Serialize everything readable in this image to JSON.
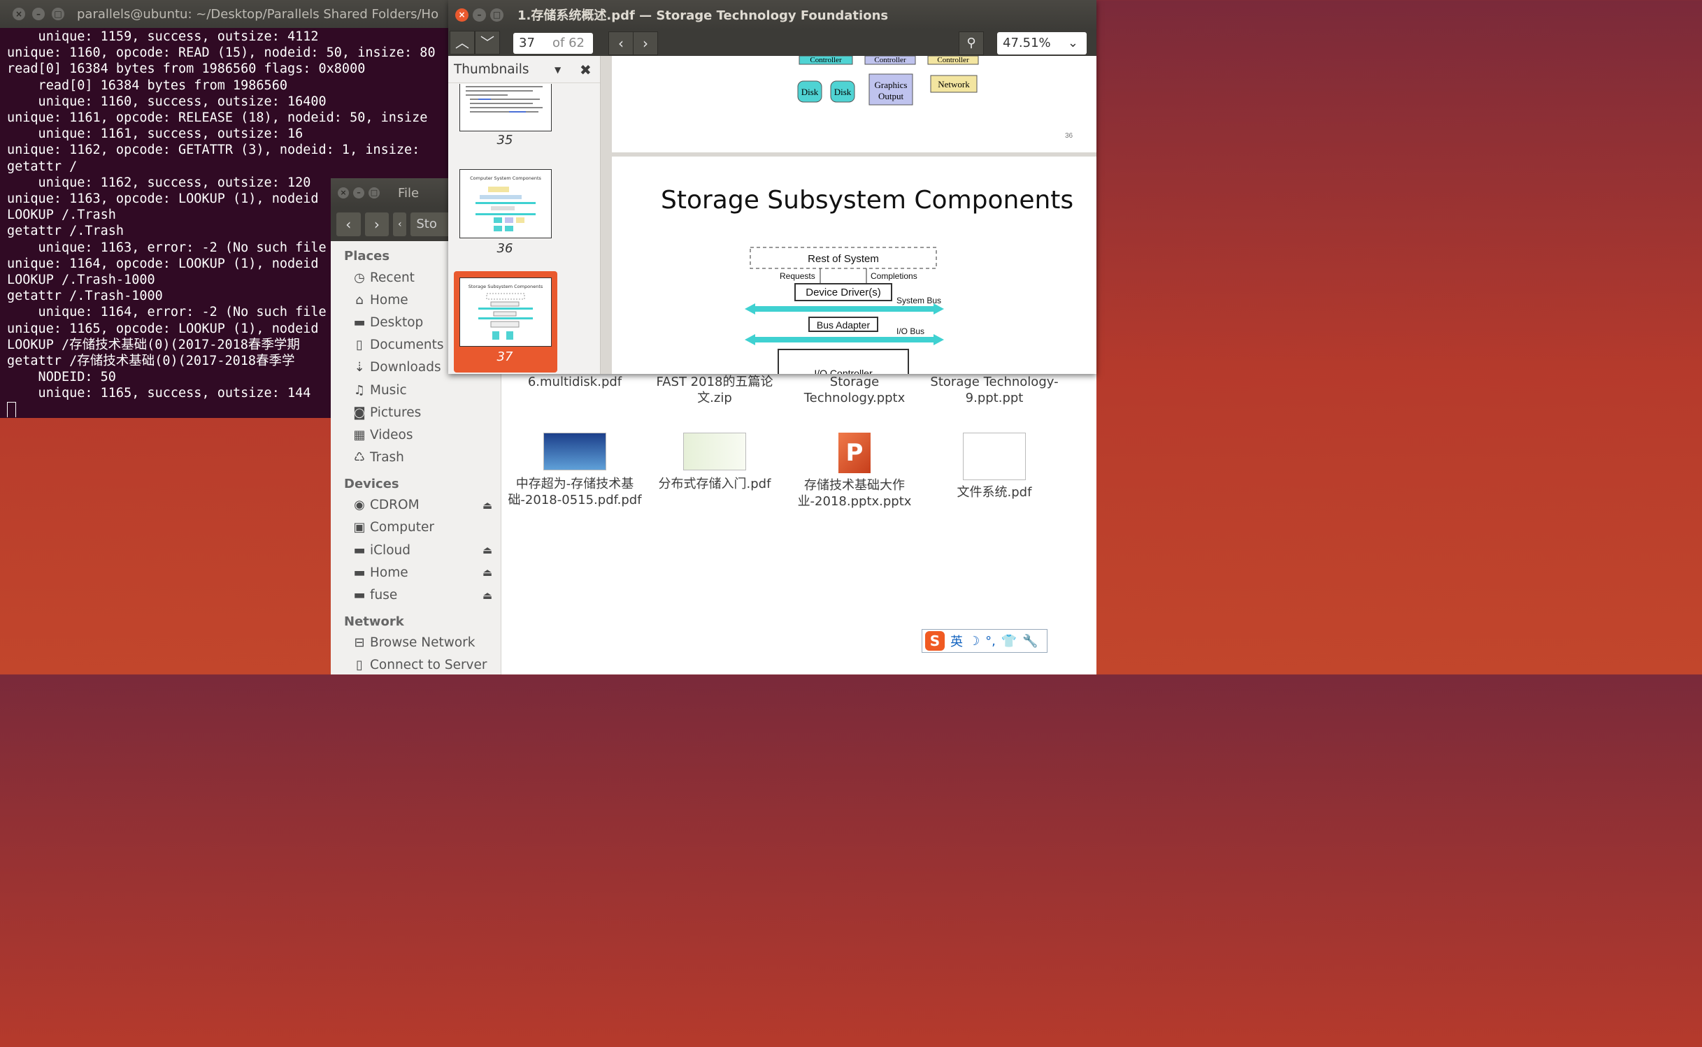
{
  "terminal": {
    "title": "parallels@ubuntu: ~/Desktop/Parallels Shared Folders/Ho",
    "lines": [
      "    unique: 1159, success, outsize: 4112",
      "unique: 1160, opcode: READ (15), nodeid: 50, insize: 80",
      "read[0] 16384 bytes from 1986560 flags: 0x8000",
      "    read[0] 16384 bytes from 1986560",
      "    unique: 1160, success, outsize: 16400",
      "unique: 1161, opcode: RELEASE (18), nodeid: 50, insize",
      "    unique: 1161, success, outsize: 16",
      "unique: 1162, opcode: GETATTR (3), nodeid: 1, insize: ",
      "getattr /",
      "    unique: 1162, success, outsize: 120",
      "unique: 1163, opcode: LOOKUP (1), nodeid",
      "LOOKUP /.Trash",
      "getattr /.Trash",
      "    unique: 1163, error: -2 (No such file",
      "unique: 1164, opcode: LOOKUP (1), nodeid",
      "LOOKUP /.Trash-1000",
      "getattr /.Trash-1000",
      "    unique: 1164, error: -2 (No such file",
      "unique: 1165, opcode: LOOKUP (1), nodeid",
      "LOOKUP /存储技术基础(0)(2017-2018春季学期",
      "getattr /存储技术基础(0)(2017-2018春季学",
      "    NODEID: 50",
      "    unique: 1165, success, outsize: 144"
    ]
  },
  "files": {
    "title": "File",
    "path_label": "Sto",
    "places_heading": "Places",
    "places": [
      {
        "icon": "clock-icon",
        "glyph": "◷",
        "label": "Recent"
      },
      {
        "icon": "home-icon",
        "glyph": "⌂",
        "label": "Home"
      },
      {
        "icon": "folder-icon",
        "glyph": "▬",
        "label": "Desktop"
      },
      {
        "icon": "document-icon",
        "glyph": "▯",
        "label": "Documents"
      },
      {
        "icon": "download-icon",
        "glyph": "⇣",
        "label": "Downloads"
      },
      {
        "icon": "music-icon",
        "glyph": "♫",
        "label": "Music"
      },
      {
        "icon": "camera-icon",
        "glyph": "◙",
        "label": "Pictures"
      },
      {
        "icon": "film-icon",
        "glyph": "▦",
        "label": "Videos"
      },
      {
        "icon": "trash-icon",
        "glyph": "♺",
        "label": "Trash"
      }
    ],
    "devices_heading": "Devices",
    "devices": [
      {
        "icon": "disc-icon",
        "glyph": "◉",
        "label": "CDROM",
        "eject": true
      },
      {
        "icon": "computer-icon",
        "glyph": "▣",
        "label": "Computer",
        "eject": false
      },
      {
        "icon": "drive-icon",
        "glyph": "▬",
        "label": "iCloud",
        "eject": true
      },
      {
        "icon": "drive-icon",
        "glyph": "▬",
        "label": "Home",
        "eject": true
      },
      {
        "icon": "drive-icon",
        "glyph": "▬",
        "label": "fuse",
        "eject": true
      }
    ],
    "network_heading": "Network",
    "network": [
      {
        "icon": "network-icon",
        "glyph": "⊟",
        "label": "Browse Network"
      },
      {
        "icon": "server-icon",
        "glyph": "▯",
        "label": "Connect to Server"
      }
    ],
    "items_row1": [
      {
        "name": "6.multidisk.pdf"
      },
      {
        "name": "FAST 2018的五篇论文.zip"
      },
      {
        "name": "Storage Technology.pptx"
      },
      {
        "name": "Storage Technology-9.ppt.ppt"
      }
    ],
    "items_row2": [
      {
        "name": "中存超为-存储技术基础-2018-0515.pdf.pdf",
        "kind": "pdf-blue"
      },
      {
        "name": "分布式存储入门.pdf",
        "kind": "pdf-green"
      },
      {
        "name": "存储技术基础大作业-2018.pptx.pptx",
        "kind": "pptx"
      },
      {
        "name": "文件系统.pdf",
        "kind": "pdf-white"
      }
    ]
  },
  "pdf": {
    "title": "1.存储系统概述.pdf — Storage Technology Foundations",
    "page_current": "37",
    "page_total": "of 62",
    "zoom": "47.51%",
    "sidebar_title": "Thumbnails",
    "thumbs": [
      {
        "num": "35",
        "caption": ""
      },
      {
        "num": "36",
        "caption": "Computer System Components"
      },
      {
        "num": "37",
        "caption": "Storage Subsystem Components"
      }
    ],
    "page36_number": "36",
    "page36_labels": {
      "controller1": "Controller",
      "controller2": "Controller",
      "controller3": "Controller",
      "disk1": "Disk",
      "disk2": "Disk",
      "graphics_line1": "Graphics",
      "graphics_line2": "Output",
      "network": "Network"
    },
    "slide_title": "Storage Subsystem Components",
    "diagram": {
      "rest": "Rest of System",
      "requests": "Requests",
      "completions": "Completions",
      "driver": "Device Driver(s)",
      "system_bus": "System Bus",
      "adapter": "Bus Adapter",
      "io_bus": "I/O Bus",
      "io_controller": "I/O Controller"
    }
  },
  "ime": {
    "logo": "S",
    "lang": "英",
    "items": [
      "☽",
      "°,",
      "👕",
      "🔧"
    ]
  }
}
